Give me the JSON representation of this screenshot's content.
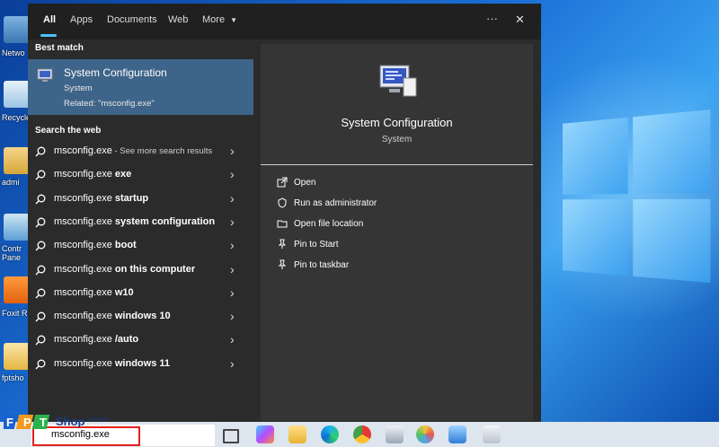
{
  "tabs": [
    {
      "label": "All"
    },
    {
      "label": "Apps"
    },
    {
      "label": "Documents"
    },
    {
      "label": "Web"
    },
    {
      "label": "More"
    }
  ],
  "window_controls": {
    "more_glyph": "···",
    "close_glyph": "✕"
  },
  "desktop": {
    "icons": [
      {
        "label": "Netwo",
        "icon": "network-icon"
      },
      {
        "label": "Recycle",
        "icon": "recycle-bin-icon"
      },
      {
        "label": "admi",
        "icon": "user-folder-icon"
      },
      {
        "label": "Contr Pane",
        "icon": "control-panel-icon"
      },
      {
        "label": "Foxit Re",
        "icon": "foxit-pdf-icon"
      },
      {
        "label": "fptsho",
        "icon": "document-icon"
      }
    ]
  },
  "left": {
    "best_match_heading": "Best match",
    "best_match": {
      "title": "System Configuration",
      "type": "System",
      "related": "Related: \"msconfig.exe\"",
      "icon": "system-configuration-icon"
    },
    "web_heading": "Search the web",
    "web_results": [
      {
        "prefix": "msconfig.exe",
        "bold": "",
        "sub": " - See more search results"
      },
      {
        "prefix": "msconfig.exe ",
        "bold": "exe",
        "sub": ""
      },
      {
        "prefix": "msconfig.exe ",
        "bold": "startup",
        "sub": ""
      },
      {
        "prefix": "msconfig.exe ",
        "bold": "system configuration",
        "sub": ""
      },
      {
        "prefix": "msconfig.exe ",
        "bold": "boot",
        "sub": ""
      },
      {
        "prefix": "msconfig.exe ",
        "bold": "on this computer",
        "sub": ""
      },
      {
        "prefix": "msconfig.exe ",
        "bold": "w10",
        "sub": ""
      },
      {
        "prefix": "msconfig.exe ",
        "bold": "windows 10",
        "sub": ""
      },
      {
        "prefix": "msconfig.exe ",
        "bold": "/auto",
        "sub": ""
      },
      {
        "prefix": "msconfig.exe ",
        "bold": "windows 11",
        "sub": ""
      }
    ]
  },
  "right": {
    "title": "System Configuration",
    "subtitle": "System",
    "actions": [
      {
        "label": "Open",
        "icon": "open-icon"
      },
      {
        "label": "Run as administrator",
        "icon": "shield-icon"
      },
      {
        "label": "Open file location",
        "icon": "folder-icon"
      },
      {
        "label": "Pin to Start",
        "icon": "pin-icon"
      },
      {
        "label": "Pin to taskbar",
        "icon": "pin-icon"
      }
    ]
  },
  "taskbar": {
    "search_query": "msconfig.exe",
    "watermark": "FPTShop.com.vn",
    "apps": [
      "task-view-icon",
      "copilot-icon",
      "file-explorer-icon",
      "edge-icon",
      "chrome-icon",
      "app-icon",
      "paint-icon",
      "remote-desktop-icon",
      "app-icon"
    ]
  },
  "colors": {
    "accent": "#4cc2ff",
    "selected_row": "#3e6489",
    "panel_bg": "#2b2b2b",
    "preview_bg": "#353535",
    "highlight_box": "#e2211c"
  }
}
